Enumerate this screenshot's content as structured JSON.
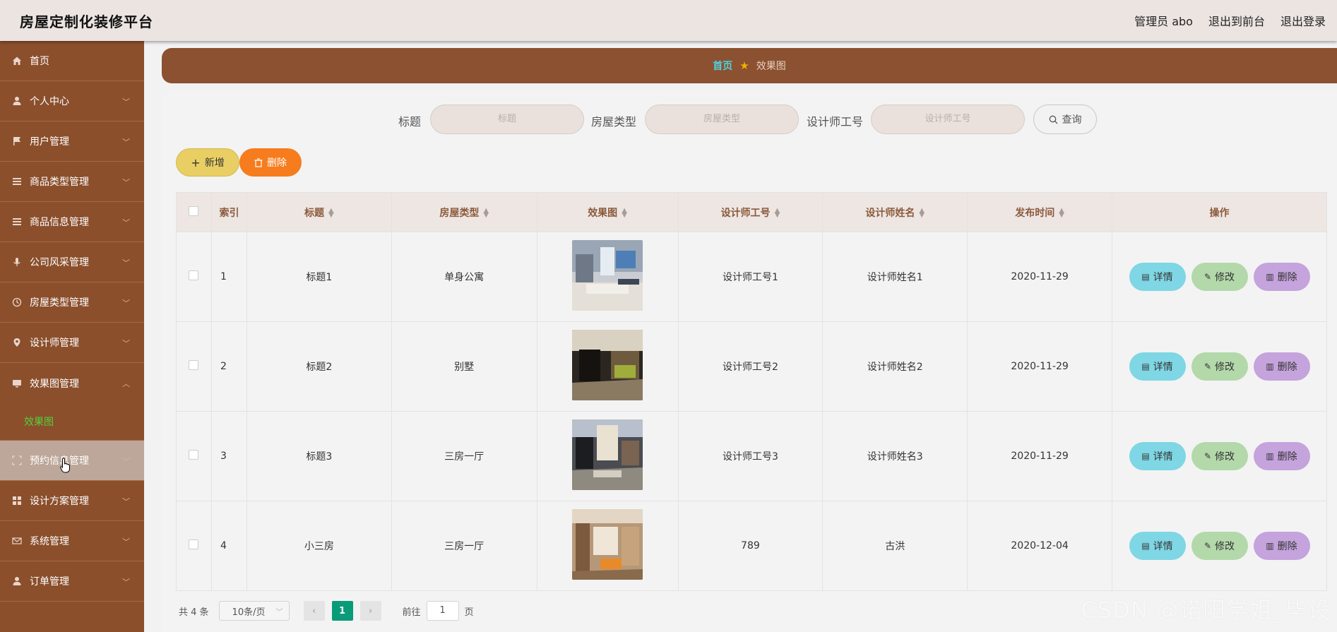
{
  "app": {
    "title": "房屋定制化装修平台",
    "user_label": "管理员 abo",
    "to_front_label": "退出到前台",
    "logout_label": "退出登录"
  },
  "sidebar": {
    "items": [
      {
        "label": "首页",
        "icon": "home-icon"
      },
      {
        "label": "个人中心",
        "icon": "user-icon"
      },
      {
        "label": "用户管理",
        "icon": "flag-icon"
      },
      {
        "label": "商品类型管理",
        "icon": "list-icon"
      },
      {
        "label": "商品信息管理",
        "icon": "list-icon"
      },
      {
        "label": "公司风采管理",
        "icon": "mic-icon"
      },
      {
        "label": "房屋类型管理",
        "icon": "clock-icon"
      },
      {
        "label": "设计师管理",
        "icon": "pin-icon"
      },
      {
        "label": "效果图管理",
        "icon": "monitor-icon"
      },
      {
        "label": "预约信息管理",
        "icon": "frame-icon"
      },
      {
        "label": "设计方案管理",
        "icon": "grid-icon"
      },
      {
        "label": "系统管理",
        "icon": "mail-icon"
      },
      {
        "label": "订单管理",
        "icon": "user-icon"
      }
    ],
    "sub_item": "效果图"
  },
  "breadcrumb": {
    "home": "首页",
    "current": "效果图"
  },
  "search": {
    "title_label": "标题",
    "title_placeholder": "标题",
    "type_label": "房屋类型",
    "type_placeholder": "房屋类型",
    "designer_label": "设计师工号",
    "designer_placeholder": "设计师工号",
    "query_label": "查询"
  },
  "actions": {
    "add_label": "新增",
    "delete_label": "删除"
  },
  "table": {
    "headers": {
      "index": "索引",
      "title": "标题",
      "type": "房屋类型",
      "image": "效果图",
      "designer_no": "设计师工号",
      "designer_name": "设计师姓名",
      "date": "发布时间",
      "ops": "操作"
    },
    "rows": [
      {
        "index": "1",
        "title": "标题1",
        "type": "单身公寓",
        "designer_no": "设计师工号1",
        "designer_name": "设计师姓名1",
        "date": "2020-11-29"
      },
      {
        "index": "2",
        "title": "标题2",
        "type": "别墅",
        "designer_no": "设计师工号2",
        "designer_name": "设计师姓名2",
        "date": "2020-11-29"
      },
      {
        "index": "3",
        "title": "标题3",
        "type": "三房一厅",
        "designer_no": "设计师工号3",
        "designer_name": "设计师姓名3",
        "date": "2020-11-29"
      },
      {
        "index": "4",
        "title": "小三房",
        "type": "三房一厅",
        "designer_no": "789",
        "designer_name": "古洪",
        "date": "2020-12-04"
      }
    ],
    "op_detail": "详情",
    "op_edit": "修改",
    "op_delete": "删除"
  },
  "pager": {
    "total": "共 4 条",
    "page_size": "10条/页",
    "current_page": "1",
    "goto_label": "前往",
    "goto_value": "1",
    "page_unit": "页"
  },
  "watermark": "CSDN @诺阳学姐_毕设",
  "colors": {
    "sidebar": "#8b4f2c",
    "active_sub": "#53d13a",
    "accent_page": "#0a9b78",
    "btn_add": "#e9cf63",
    "btn_delete": "#f67c1d"
  }
}
